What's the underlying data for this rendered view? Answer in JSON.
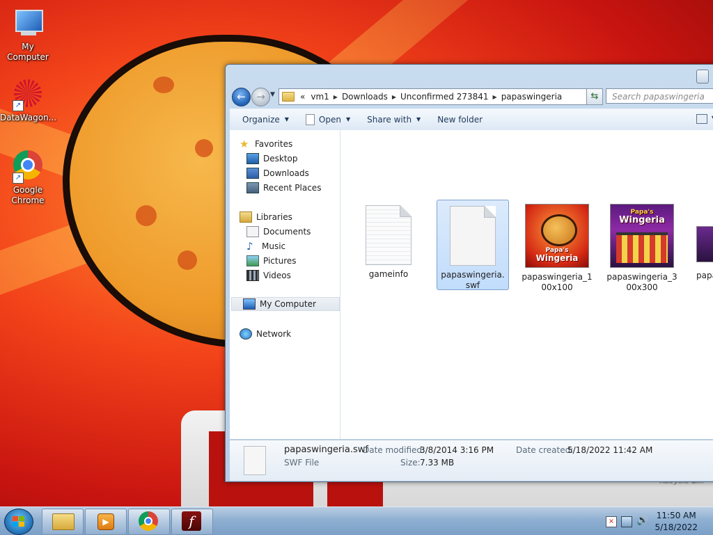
{
  "desktop": {
    "icons": [
      {
        "label": "My Computer",
        "icon": "computer-icon"
      },
      {
        "label": "DataWagon...",
        "icon": "datawagon-icon"
      },
      {
        "label": "Google Chrome",
        "icon": "chrome-icon"
      }
    ],
    "recycle_bin_label": "Recycle Bin"
  },
  "explorer": {
    "address": {
      "overflow": "«",
      "crumbs": [
        "vm1",
        "Downloads",
        "Unconfirmed 273841",
        "papaswingeria"
      ]
    },
    "search_placeholder": "Search papaswingeria",
    "toolbar": {
      "organize": "Organize",
      "open": "Open",
      "share_with": "Share with",
      "new_folder": "New folder"
    },
    "nav": {
      "favorites": "Favorites",
      "desktop": "Desktop",
      "downloads": "Downloads",
      "recent_places": "Recent Places",
      "libraries": "Libraries",
      "documents": "Documents",
      "music": "Music",
      "pictures": "Pictures",
      "videos": "Videos",
      "my_computer": "My Computer",
      "network": "Network"
    },
    "files": [
      {
        "name": "gameinfo",
        "type": "text-document"
      },
      {
        "name": "papaswingeria.swf",
        "type": "swf-file",
        "selected": true
      },
      {
        "name": "papaswingeria_100x100",
        "type": "image"
      },
      {
        "name": "papaswingeria_300x300",
        "type": "image"
      },
      {
        "name": "papa",
        "type": "image"
      }
    ],
    "thumb_text": {
      "brand": "Papa's",
      "name": "Wingeria"
    },
    "details": {
      "filename": "papaswingeria.swf",
      "filetype": "SWF File",
      "date_modified_label": "Date modified:",
      "date_modified": "3/8/2014 3:16 PM",
      "size_label": "Size:",
      "size": "7.33 MB",
      "date_created_label": "Date created:",
      "date_created": "5/18/2022 11:42 AM"
    }
  },
  "taskbar": {
    "apps": [
      "explorer-icon",
      "media-player-icon",
      "chrome-icon",
      "flash-icon"
    ],
    "time": "11:50 AM",
    "date": "5/18/2022"
  }
}
